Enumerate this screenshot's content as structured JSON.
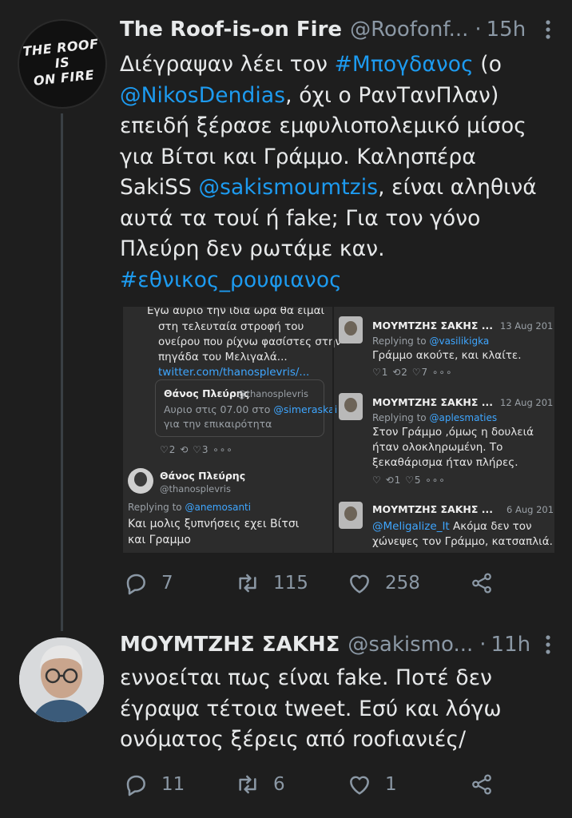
{
  "tweet1": {
    "avatar_text": [
      "THE ROOF",
      "IS",
      "ON FIRE"
    ],
    "display_name": "The Roof-is-on Fire",
    "handle": "@Roofonf...",
    "time": "15h",
    "text": {
      "l1a": "Διέγραψαν λέει τον ",
      "l1b": "#Μπογδανος",
      "l1c": " (ο",
      "l2a": "@NikosDendias",
      "l2b": ", όχι ο ΡανΤανΠλαν)",
      "l3": "επειδή ξέρασε εμφυλιοπολεμικό μίσος",
      "l4": "για Βίτσι και Γράμμο. Καλησπέρα",
      "l5a": "SakiSS ",
      "l5b": "@sakismoumtzis",
      "l5c": ", είναι αληθινά",
      "l6": "αυτά τα τουί ή fake; Για τον γόνο",
      "l7": "Πλεύρη δεν ρωτάμε καν.",
      "l8": "#εθνικος_ρουφιανος"
    },
    "embed": {
      "left": {
        "t1": "Εγω αυριο την ιδια ωρα θα ειμαι",
        "t2": "στη τελευταία στροφή του",
        "t3": "ονείρου που ρίχνω φασίστες στην",
        "t4": "πηγάδα του Μελιγαλά...",
        "t5": "twitter.com/thanosplevris/...",
        "quote_name": "Θάνος Πλεύρης",
        "quote_handle": "@thanosplevris",
        "quote_l1a": "Αυριο στις 07.00 στο ",
        "quote_l1b": "@simeraskai",
        "quote_l2": "για την επικαιρότητα",
        "icons1": "♡2  ⟲  ♡3  ∘∘∘",
        "name2": "Θάνος Πλεύρης",
        "handle2": "@thanosplevris",
        "reply_a": "Replying to ",
        "reply_b": "@anemosanti",
        "text2a": "Και μολις ξυπνήσεις εχει Βίτσι",
        "text2b": "και Γραμμο"
      },
      "right": {
        "name": "ΜΟΥΜΤΖΗΣ ΣΑΚΗΣ ...",
        "d1": "13 Aug 201",
        "r1a": "Replying to ",
        "r1b": "@vasilikigka",
        "r1t": "Γράμμο ακούτε, και κλαίτε.",
        "i1": "♡1  ⟲2  ♡7  ∘∘∘",
        "d2": "12 Aug 201",
        "r2a": "Replying to ",
        "r2b": "@aplesmaties",
        "r2t1": "Στον Γράμμο ,όμως η δουλειά",
        "r2t2": "ήταν ολοκληρωμένη. Το",
        "r2t3": "ξεκαθάρισμα ήταν πλήρες.",
        "i2": "♡  ⟲1  ♡5  ∘∘∘",
        "d3": "6 Aug 201",
        "r3a": "@Meligalize_It",
        "r3b": "  Ακόμα δεν τον",
        "r3t2": "χώνεψες τον Γράμμο, κατσαπλιά."
      }
    },
    "stats": {
      "replies": "7",
      "retweets": "115",
      "likes": "258"
    }
  },
  "tweet2": {
    "display_name": "ΜΟΥΜΤΖΗΣ ΣΑΚΗΣ",
    "handle": "@sakismo...",
    "time": "11h",
    "text": {
      "l1": "εννοείται πως είναι fake. Ποτέ δεν",
      "l2": "έγραψα τέτοια tweet. Εσύ και λόγω",
      "l3": "ονόματος ξέρεις από roofιανιές/"
    },
    "stats": {
      "replies": "11",
      "retweets": "6",
      "likes": "1"
    }
  },
  "icons": {
    "reply": "reply-icon",
    "retweet": "retweet-icon",
    "like": "heart-icon",
    "share": "share-icon",
    "more": "more-vertical-icon"
  },
  "colors": {
    "background": "#1e1e1e",
    "link": "#1d9bf0",
    "muted": "#8b98a5"
  }
}
